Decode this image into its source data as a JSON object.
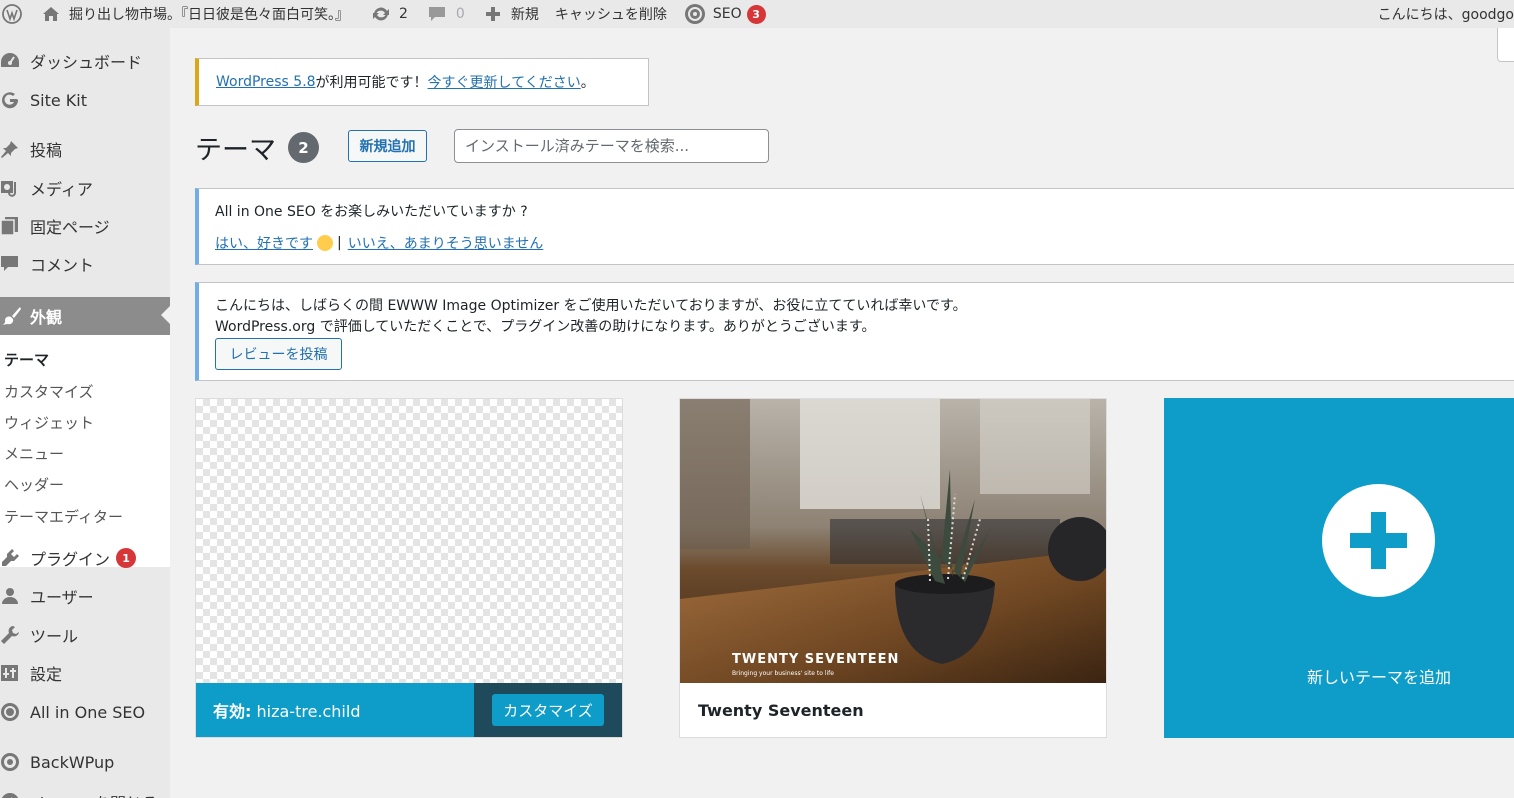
{
  "admin_bar": {
    "site_name": "掘り出し物市場。『日日彼是色々面白可笑。』",
    "updates_count": "2",
    "comments_count": "0",
    "new_label": "新規",
    "cache_label": "キャッシュを削除",
    "seo_label": "SEO",
    "seo_badge": "3",
    "greeting": "こんにちは、goodgo"
  },
  "sidebar": {
    "items": [
      {
        "label": "ダッシュボード",
        "icon": "dashboard-icon"
      },
      {
        "label": "Site Kit",
        "icon": "google-g-icon"
      },
      {
        "label": "投稿",
        "icon": "pushpin-icon"
      },
      {
        "label": "メディア",
        "icon": "media-icon"
      },
      {
        "label": "固定ページ",
        "icon": "page-icon"
      },
      {
        "label": "コメント",
        "icon": "comment-icon"
      },
      {
        "label": "外観",
        "icon": "paintbrush-icon"
      },
      {
        "label": "プラグイン",
        "icon": "plugin-icon",
        "badge": "1"
      },
      {
        "label": "ユーザー",
        "icon": "user-icon"
      },
      {
        "label": "ツール",
        "icon": "wrench-icon"
      },
      {
        "label": "設定",
        "icon": "settings-icon"
      },
      {
        "label": "All in One SEO",
        "icon": "gear-icon"
      },
      {
        "label": "BackWPup",
        "icon": "backwpup-icon"
      },
      {
        "label": "メニューを閉じる",
        "icon": "collapse-icon"
      }
    ],
    "submenu": [
      "テーマ",
      "カスタマイズ",
      "ウィジェット",
      "メニュー",
      "ヘッダー",
      "テーマエディター"
    ]
  },
  "update_notice": {
    "link1": "WordPress 5.8",
    "text": " が利用可能です！",
    "link2": "今すぐ更新してください",
    "end": "。"
  },
  "heading": {
    "title": "テーマ",
    "count": "2",
    "add_new": "新規追加",
    "search_placeholder": "インストール済みテーマを検索..."
  },
  "seo_notice": {
    "question": "All in One SEO をお楽しみいただいていますか ?",
    "yes": "はい、好きです",
    "separator": "|",
    "no": "いいえ、あまりそう思いません"
  },
  "ewww_notice": {
    "line1": "こんにちは、しばらくの間 EWWW Image Optimizer をご使用いただいておりますが、お役に立てていれば幸いです。",
    "line2": "WordPress.org で評価していただくことで、プラグイン改善の助けになります。ありがとうございます。",
    "button": "レビューを投稿"
  },
  "themes": {
    "active": {
      "prefix": "有効:",
      "name": "hiza-tre.child",
      "button": "カスタマイズ"
    },
    "second": {
      "name": "Twenty Seventeen",
      "shot_title": "TWENTY SEVENTEEN",
      "shot_tagline": "Bringing your business' site to life"
    },
    "add": {
      "label": "新しいテーマを追加"
    }
  },
  "colors": {
    "accent": "#0e9cc8",
    "badge": "#d63638",
    "link": "#2271b1"
  }
}
